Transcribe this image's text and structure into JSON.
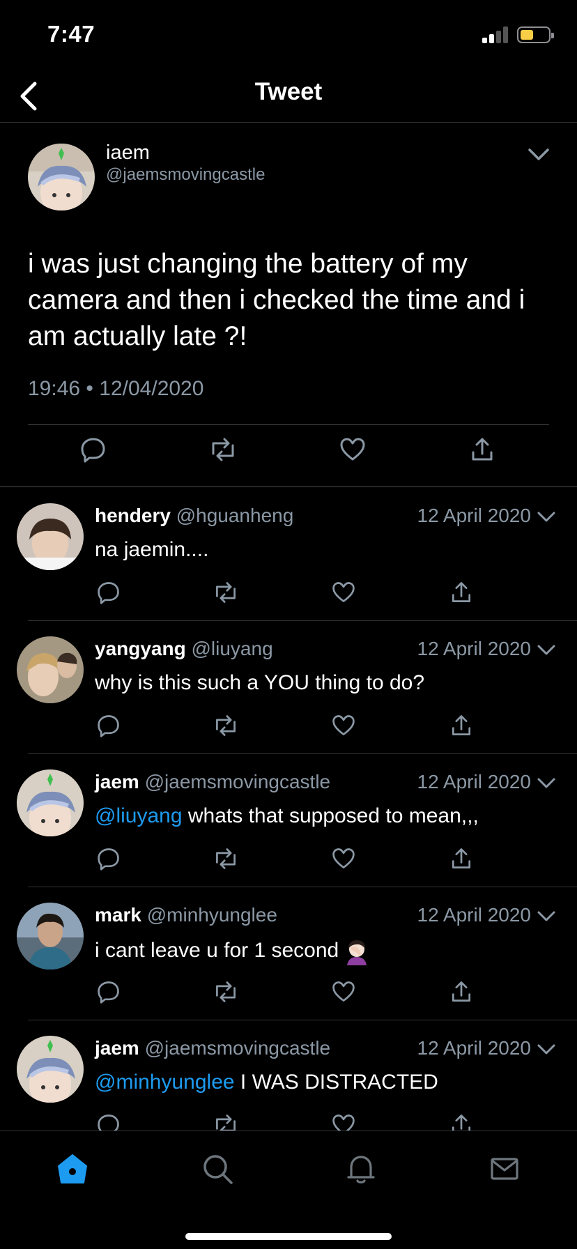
{
  "status": {
    "time": "7:47"
  },
  "nav": {
    "title": "Tweet"
  },
  "main_tweet": {
    "name": "iaem",
    "handle": "@jaemsmovingcastle",
    "text": "i was just changing the battery of my camera and then i checked the time and i am actually late ?!",
    "time": "19:46",
    "separator": "•",
    "date": "12/04/2020"
  },
  "replies": [
    {
      "name": "hendery",
      "handle": "@hguanheng",
      "date": "12 April 2020",
      "mention": "",
      "text": "na jaemin...."
    },
    {
      "name": "yangyang",
      "handle": "@liuyang",
      "date": "12 April 2020",
      "mention": "",
      "text": "why is this such a YOU thing to do?"
    },
    {
      "name": "jaem",
      "handle": "@jaemsmovingcastle",
      "date": "12 April 2020",
      "mention": "@liuyang",
      "text": " whats that supposed to mean,,,"
    },
    {
      "name": "mark",
      "handle": "@minhyunglee",
      "date": "12 April 2020",
      "mention": "",
      "text": "i cant leave u for 1 second"
    },
    {
      "name": "jaem",
      "handle": "@jaemsmovingcastle",
      "date": "12 April 2020",
      "mention": "@minhyunglee",
      "text": " I WAS DISTRACTED"
    }
  ],
  "icons": {
    "back": "chevron-left-icon",
    "more": "chevron-down-icon",
    "reply": "reply-icon",
    "retweet": "retweet-icon",
    "like": "heart-icon",
    "share": "share-icon",
    "facepalm": "facepalm-emoji",
    "tabs": [
      "home-icon",
      "search-icon",
      "bell-icon",
      "mail-icon"
    ]
  },
  "colors": {
    "accent": "#1d9bf0",
    "secondary_text": "#8b98a5",
    "background": "#000000",
    "battery": "#f7ce46"
  }
}
